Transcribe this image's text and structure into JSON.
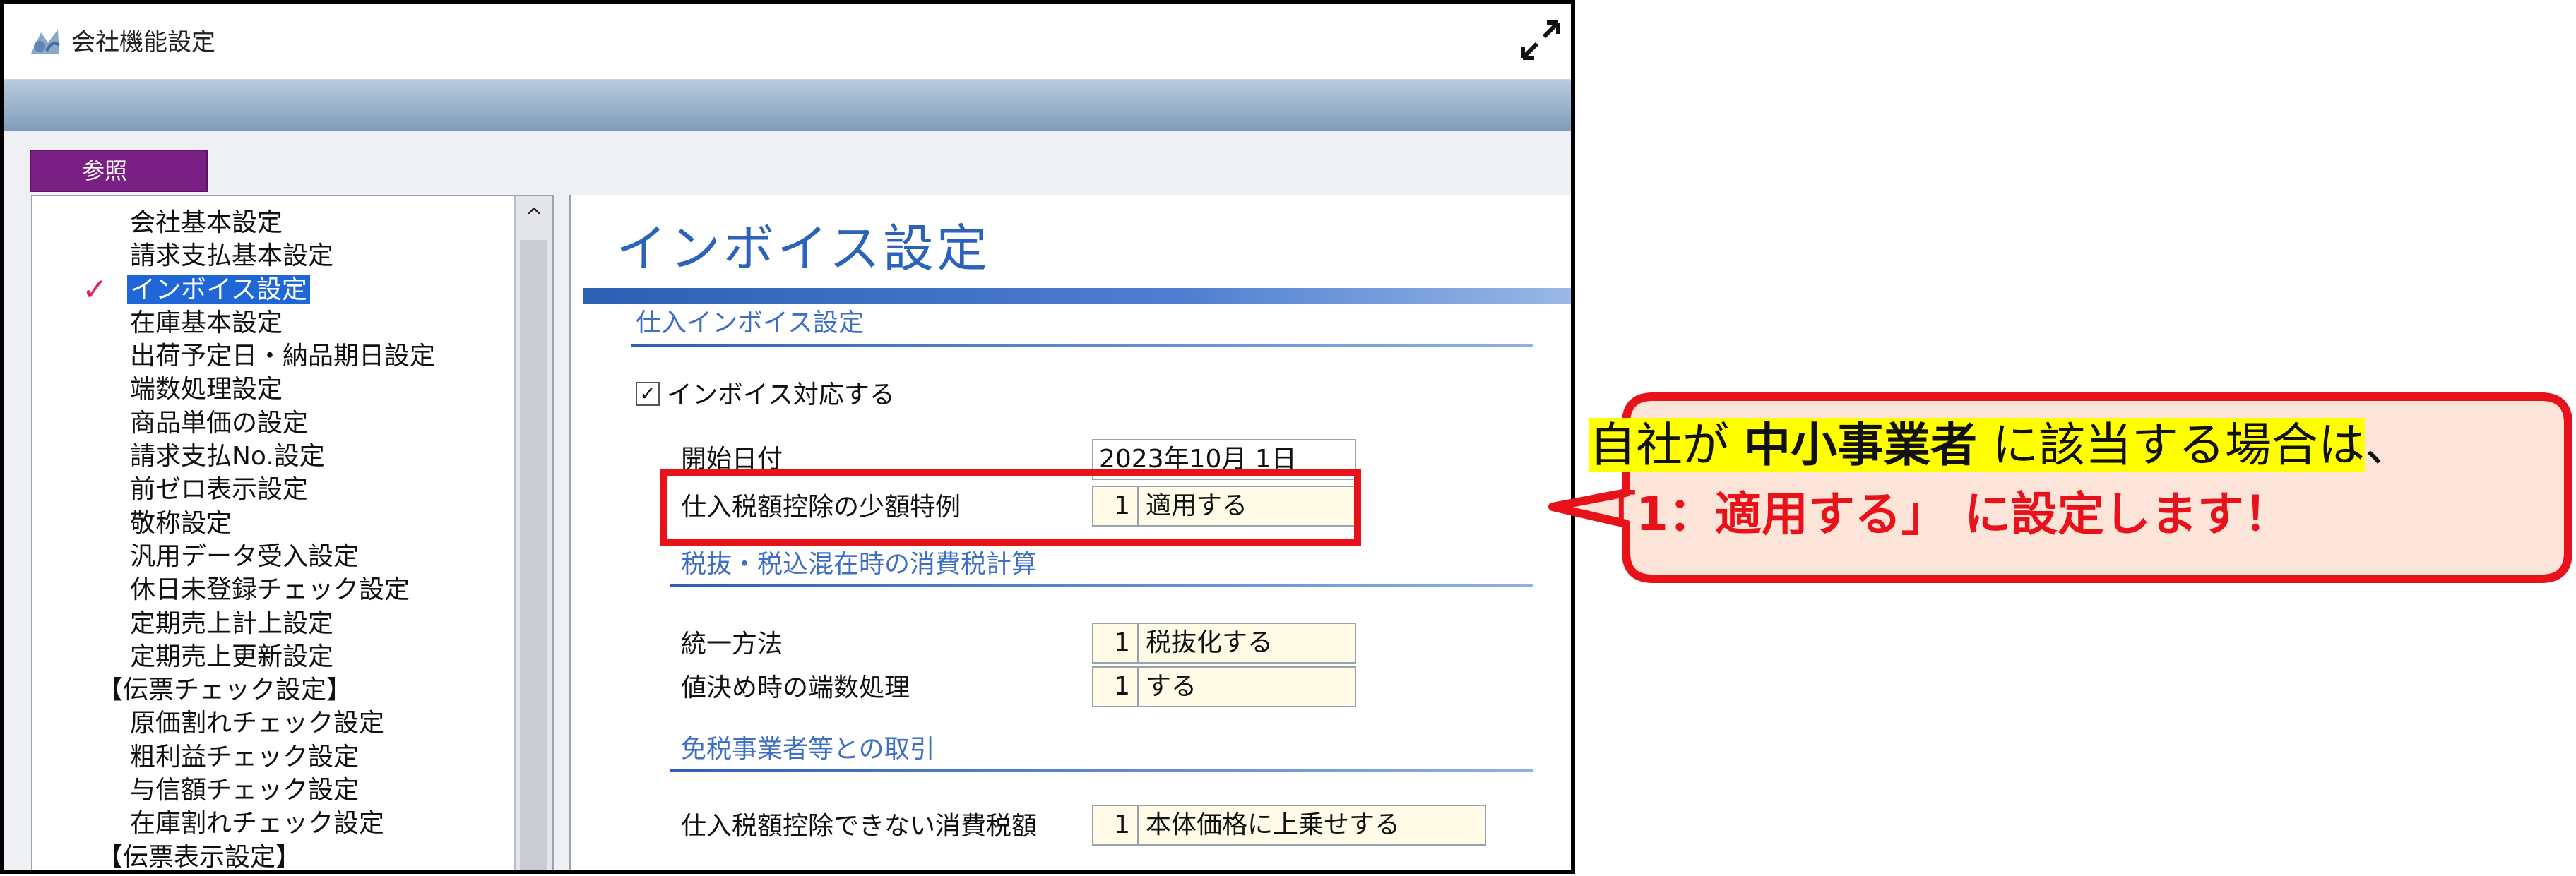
{
  "window": {
    "title": "会社機能設定",
    "tab_label": "参照",
    "maximize_icon": "expand-arrows-icon"
  },
  "tree": {
    "items": [
      {
        "label": "会社基本設定",
        "level": 1
      },
      {
        "label": "請求支払基本設定",
        "level": 1
      },
      {
        "label": "インボイス設定",
        "level": 1,
        "selected": true
      },
      {
        "label": "在庫基本設定",
        "level": 1
      },
      {
        "label": "出荷予定日・納品期日設定",
        "level": 1
      },
      {
        "label": "端数処理設定",
        "level": 1
      },
      {
        "label": "商品単価の設定",
        "level": 1
      },
      {
        "label": "請求支払No.設定",
        "level": 1
      },
      {
        "label": "前ゼロ表示設定",
        "level": 1
      },
      {
        "label": "敬称設定",
        "level": 1
      },
      {
        "label": "汎用データ受入設定",
        "level": 1
      },
      {
        "label": "休日未登録チェック設定",
        "level": 1
      },
      {
        "label": "定期売上計上設定",
        "level": 1
      },
      {
        "label": "定期売上更新設定",
        "level": 1
      },
      {
        "label": "【伝票チェック設定】",
        "level": 0
      },
      {
        "label": "原価割れチェック設定",
        "level": 1
      },
      {
        "label": "粗利益チェック設定",
        "level": 1
      },
      {
        "label": "与信額チェック設定",
        "level": 1
      },
      {
        "label": "在庫割れチェック設定",
        "level": 1
      },
      {
        "label": "【伝票表示設定】",
        "level": 0
      }
    ],
    "check_mark": "✓",
    "scroll_up": "^"
  },
  "content": {
    "title": "インボイス設定",
    "section_purchase": "仕入インボイス設定",
    "invoice_checkbox_label": "インボイス対応する",
    "invoice_checkbox_mark": "☑",
    "start_date_label": "開始日付",
    "start_date_value": "2023年10月 1日",
    "small_amount_label": "仕入税額控除の少額特例",
    "small_amount_code": "1",
    "small_amount_value": "適用する",
    "section_tax": "税抜・税込混在時の消費税計算",
    "unify_label": "統一方法",
    "unify_code": "1",
    "unify_value": "税抜化する",
    "rounding_label": "値決め時の端数処理",
    "rounding_code": "1",
    "rounding_value": "する",
    "section_exempt": "免税事業者等との取引",
    "nondeductible_label": "仕入税額控除できない消費税額",
    "nondeductible_code": "1",
    "nondeductible_value": "本体価格に上乗せする"
  },
  "callout": {
    "line1_pre": "自社が ",
    "line1_bold": "中小事業者",
    "line1_post": " に該当する場合は",
    "line1_tail": "、",
    "line2": "「1：適用する」 に設定します！"
  },
  "colors": {
    "accent_red": "#e8131a",
    "callout_fill": "#fde4d8",
    "highlight_yellow": "#ffff00",
    "tab_purple": "#7a1f84",
    "title_blue": "#2a63b8",
    "selection_blue": "#1f67d6"
  }
}
